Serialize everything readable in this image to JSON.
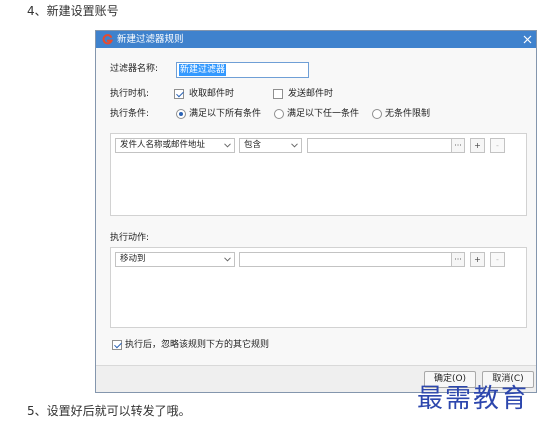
{
  "page": {
    "step4_text": "4、新建设置账号",
    "step5_text": "5、设置好后就可以转发了哦。",
    "watermark": "最需教育"
  },
  "dialog": {
    "title": "新建过滤器规则",
    "filter_name": {
      "label": "过滤器名称:",
      "value": "新建过滤器"
    },
    "timing": {
      "label": "执行时机:",
      "options": [
        {
          "label": "收取邮件时",
          "checked": true
        },
        {
          "label": "发送邮件时",
          "checked": false
        }
      ]
    },
    "condition_mode": {
      "label": "执行条件:",
      "options": [
        {
          "label": "满足以下所有条件",
          "selected": true
        },
        {
          "label": "满足以下任一条件",
          "selected": false
        },
        {
          "label": "无条件限制",
          "selected": false
        }
      ]
    },
    "conditions": [
      {
        "field": "发件人名称或邮件地址",
        "operator": "包含",
        "value": ""
      }
    ],
    "actions_label": "执行动作:",
    "actions": [
      {
        "action": "移动到",
        "target": ""
      }
    ],
    "row_buttons": {
      "browse": "···",
      "add": "+",
      "remove": "-"
    },
    "stop_rule": {
      "label": "执行后，忽略该规则下方的其它规则",
      "checked": true
    },
    "ok_button": "确定(O)",
    "cancel_button": "取消(C)"
  },
  "icons": {
    "app_logo": "app-logo-icon",
    "close": "close-icon",
    "dropdown": "chevron-down-icon",
    "check": "checkmark-icon"
  },
  "colors": {
    "title_bar": "#3f82cd",
    "selection": "#3399ff",
    "watermark": "#2c46ad",
    "check": "#2b63b5"
  }
}
